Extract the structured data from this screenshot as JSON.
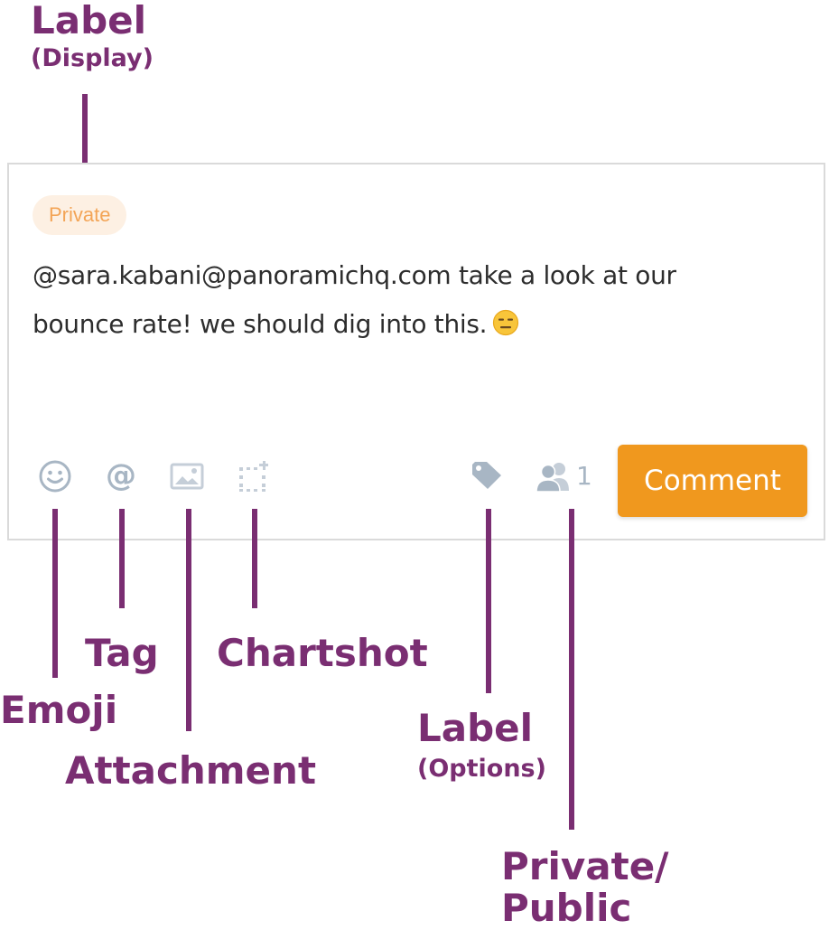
{
  "comment": {
    "label_badge": "Private",
    "text": "@sara.kabani@panoramichq.com  take a look at our bounce rate! we should dig into this.",
    "emoji_icon": "expressionless-face-emoji",
    "privacy_count": "1",
    "submit_label": "Comment"
  },
  "toolbar_icons": {
    "emoji": "smiley-icon",
    "tag": "@",
    "attachment": "image-icon",
    "chartshot": "crop-selection-icon",
    "label": "tag-icon",
    "privacy": "people-icon"
  },
  "annotations": {
    "label_display_title": "Label",
    "label_display_sub": "(Display)",
    "emoji": "Emoji",
    "tag": "Tag",
    "attachment": "Attachment",
    "chartshot": "Chartshot",
    "label_options_title": "Label",
    "label_options_sub": "(Options)",
    "privacy_line1": "Private/",
    "privacy_line2": "Public"
  },
  "colors": {
    "annotation": "#7a2e72",
    "accent": "#f0981e",
    "badge_bg": "#fdf0e3",
    "badge_text": "#f3a456",
    "icon": "#a8b6c4",
    "border": "#dadada"
  }
}
